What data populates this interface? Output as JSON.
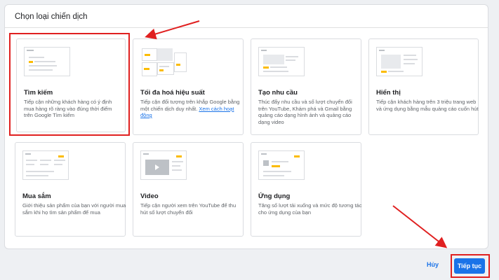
{
  "dialog": {
    "title": "Chọn loại chiến dịch"
  },
  "cards": [
    {
      "title": "Tìm kiếm",
      "desc": "Tiếp cận những khách hàng có ý định mua hàng rõ ràng vào đúng thời điểm trên Google Tìm kiếm",
      "thumb_icon": "search-thumb-icon"
    },
    {
      "title": "Tối đa hoá hiệu suất",
      "desc": "Tiếp cận đối tượng trên khắp Google bằng một chiến dịch duy nhất. ",
      "link": "Xem cách hoạt động",
      "thumb_icon": "performance-max-thumb-icon"
    },
    {
      "title": "Tạo nhu cầu",
      "desc": "Thúc đẩy nhu cầu và số lượt chuyển đổi trên YouTube, Khám phá và Gmail bằng quảng cáo dạng hình ảnh và quảng cáo dạng video",
      "thumb_icon": "demand-gen-thumb-icon"
    },
    {
      "title": "Hiển thị",
      "desc": "Tiếp cận khách hàng trên 3 triệu trang web và ứng dụng bằng mẫu quảng cáo cuốn hút",
      "thumb_icon": "display-thumb-icon"
    },
    {
      "title": "Mua sắm",
      "desc": "Giới thiệu sản phẩm của bạn với người mua sắm khi họ tìm sản phẩm để mua",
      "thumb_icon": "shopping-thumb-icon"
    },
    {
      "title": "Video",
      "desc": "Tiếp cận người xem trên YouTube để thu hút số lượt chuyển đổi",
      "thumb_icon": "video-thumb-icon"
    },
    {
      "title": "Ứng dụng",
      "desc": "Tăng số lượt tải xuống và mức độ tương tác cho ứng dụng của bạn",
      "thumb_icon": "app-thumb-icon"
    }
  ],
  "footer": {
    "cancel_label": "Hủy",
    "continue_label": "Tiếp tục"
  },
  "colors": {
    "accent": "#1a73e8",
    "highlight": "#e02020",
    "thumb_yellow": "#fbbc04"
  }
}
